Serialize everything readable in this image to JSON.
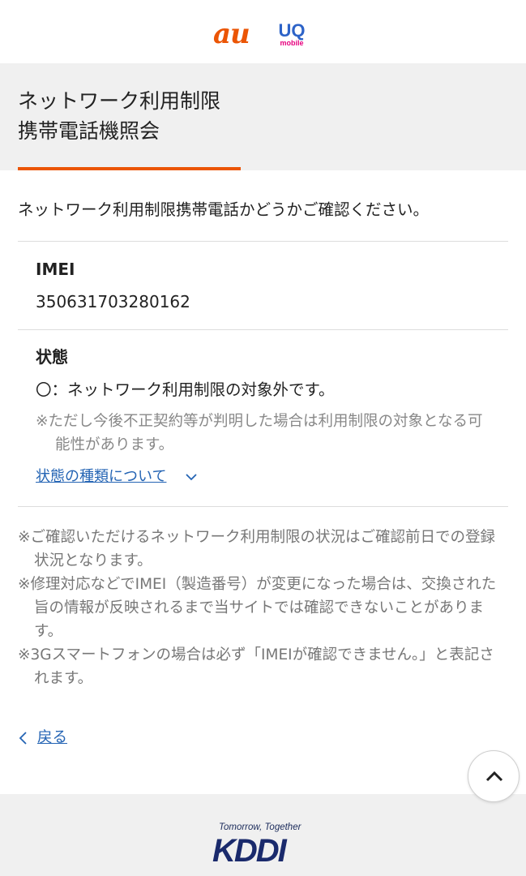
{
  "header": {
    "logo_au": "au",
    "logo_uq": "UQ",
    "logo_uq_sub": "mobile",
    "brand_colors": {
      "au": "#eb5505",
      "uq": "#2d63c8",
      "uq_sub": "#e6007e"
    }
  },
  "title": {
    "line1": "ネットワーク利用制限",
    "line2": "携帯電話機照会",
    "accent_color": "#eb5505"
  },
  "intro": "ネットワーク利用制限携帯電話かどうかご確認ください。",
  "imei": {
    "label": "IMEI",
    "value": "350631703280162"
  },
  "status": {
    "label": "状態",
    "main": "〇：ネットワーク利用制限の対象外です。",
    "note": "※ただし今後不正契約等が判明した場合は利用制限の対象となる可能性があります。",
    "types_link": "状態の種類について",
    "types_icon": "chevron-down-icon"
  },
  "notes": [
    "※ご確認いただけるネットワーク利用制限の状況はご確認前日での登録状況となります。",
    "※修理対応などでIMEI（製造番号）が変更になった場合は、交換された旨の情報が反映されるまで当サイトでは確認できないことがあります。",
    "※3Gスマートフォンの場合は必ず「IMEIが確認できません。」と表記されます。"
  ],
  "back": {
    "label": "戻る",
    "icon": "chevron-left-icon"
  },
  "scroll_top": {
    "icon": "chevron-up-icon"
  },
  "footer": {
    "tagline": "Tomorrow, Together",
    "logo": "KDDI",
    "brand_color": "#1a2a6c"
  },
  "link_color": "#2464b4"
}
